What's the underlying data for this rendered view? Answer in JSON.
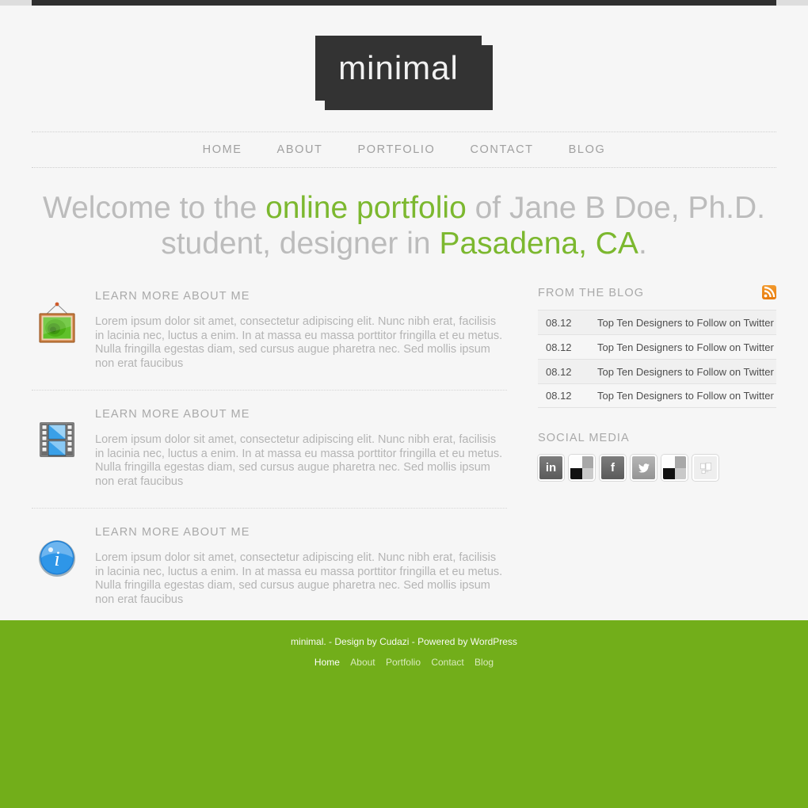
{
  "site": {
    "logo_text": "minimal",
    "logo_bg": "#333333",
    "accent_green": "#7cb82f",
    "footer_green": "#72ae1a",
    "page_bg": "#f6f6f6"
  },
  "nav": {
    "items": [
      {
        "label": "HOME"
      },
      {
        "label": "ABOUT"
      },
      {
        "label": "PORTFOLIO"
      },
      {
        "label": "CONTACT"
      },
      {
        "label": "BLOG"
      }
    ]
  },
  "headline": {
    "part1": "Welcome to the ",
    "highlight1": "online portfolio",
    "part2": " of Jane B Doe, Ph.D. student, designer in ",
    "highlight2": "Pasadena, CA",
    "part3": "."
  },
  "features": [
    {
      "icon": "framed-picture-icon",
      "title": "LEARN MORE ABOUT ME",
      "body": "Lorem ipsum dolor sit amet, consectetur adipiscing elit. Nunc nibh erat, facilisis in lacinia nec, luctus a enim. In at massa eu massa porttitor fringilla et eu metus. Nulla fringilla egestas diam, sed cursus augue pharetra nec. Sed mollis ipsum non erat faucibus"
    },
    {
      "icon": "film-strip-icon",
      "title": "LEARN MORE ABOUT ME",
      "body": "Lorem ipsum dolor sit amet, consectetur adipiscing elit. Nunc nibh erat, facilisis in lacinia nec, luctus a enim. In at massa eu massa porttitor fringilla et eu metus. Nulla fringilla egestas diam, sed cursus augue pharetra nec. Sed mollis ipsum non erat faucibus"
    },
    {
      "icon": "info-circle-icon",
      "title": "LEARN MORE ABOUT ME",
      "body": "Lorem ipsum dolor sit amet, consectetur adipiscing elit. Nunc nibh erat, facilisis in lacinia nec, luctus a enim. In at massa eu massa porttitor fringilla et eu metus. Nulla fringilla egestas diam, sed cursus augue pharetra nec. Sed mollis ipsum non erat faucibus"
    }
  ],
  "blog": {
    "title": "FROM THE BLOG",
    "rss_icon": "rss-icon",
    "rss_color": "#e87b0c",
    "posts": [
      {
        "date": "08.12",
        "title": "Top Ten Designers to Follow on Twitter"
      },
      {
        "date": "08.12",
        "title": "Top Ten Designers to Follow on Twitter"
      },
      {
        "date": "08.12",
        "title": "Top Ten Designers to Follow on Twitter"
      },
      {
        "date": "08.12",
        "title": "Top Ten Designers to Follow on Twitter"
      }
    ]
  },
  "social": {
    "title": "SOCIAL MEDIA",
    "icons": [
      {
        "name": "linkedin-icon",
        "glyph": "in"
      },
      {
        "name": "broken-image-icon",
        "glyph": ""
      },
      {
        "name": "facebook-icon",
        "glyph": "f"
      },
      {
        "name": "twitter-icon",
        "glyph": "t"
      },
      {
        "name": "broken-image-icon",
        "glyph": ""
      },
      {
        "name": "placeholder-image-icon",
        "glyph": ""
      }
    ]
  },
  "footer": {
    "credit": "minimal. - Design by Cudazi - Powered by WordPress",
    "links": [
      {
        "label": "Home",
        "current": true
      },
      {
        "label": "About",
        "current": false
      },
      {
        "label": "Portfolio",
        "current": false
      },
      {
        "label": "Contact",
        "current": false
      },
      {
        "label": "Blog",
        "current": false
      }
    ]
  }
}
